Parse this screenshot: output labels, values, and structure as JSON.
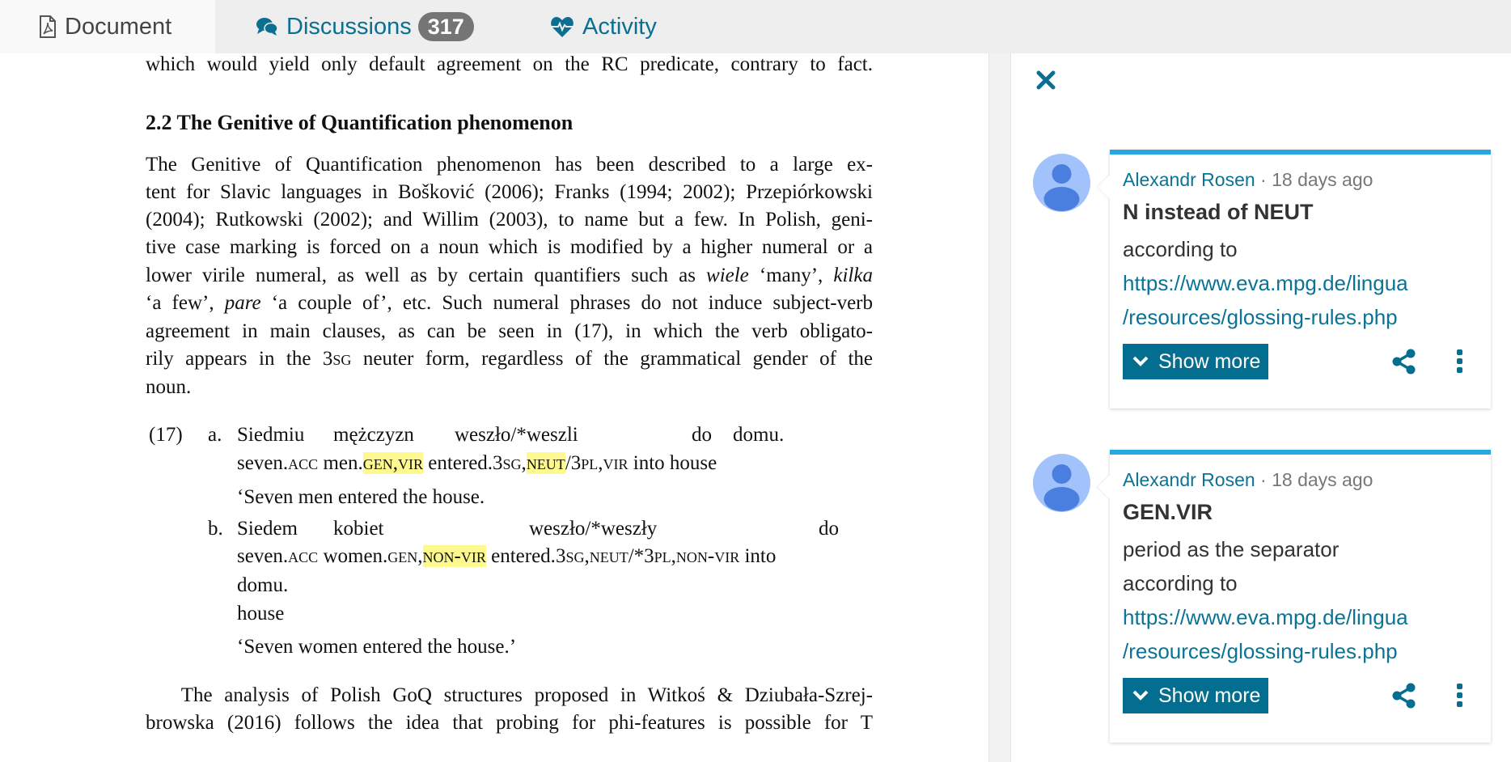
{
  "tabs": {
    "document": "Document",
    "discussions": "Discussions",
    "discussions_count": "317",
    "activity": "Activity"
  },
  "document": {
    "top_line": "which would yield only default agreement on the RC predicate, contrary to fact.",
    "section_heading": "2.2  The Genitive of Quantification phenomenon",
    "paragraph1": [
      [
        {
          "t": "The Genitive of Quantification phenomenon has been described to a large ex-"
        }
      ],
      [
        {
          "t": "tent for Slavic languages in Bošković (2006); Franks (1994; 2002); Przepiórkowski"
        }
      ],
      [
        {
          "t": "(2004); Rutkowski (2002); and Willim (2003), to name but a few. In Polish, geni-"
        }
      ],
      [
        {
          "t": "tive case marking is forced on a noun which is modified by a higher numeral or a"
        }
      ],
      [
        {
          "t": "lower virile numeral, as well as by certain quantifiers such as "
        },
        {
          "t": "wiele",
          "i": true
        },
        {
          "t": " ‘many’, "
        },
        {
          "t": "kilka",
          "i": true
        }
      ],
      [
        {
          "t": "‘a few’, "
        },
        {
          "t": "pare",
          "i": true
        },
        {
          "t": " ‘a couple of’, etc. Such numeral phrases do not induce subject-verb"
        }
      ],
      [
        {
          "t": "agreement in main clauses, as can be seen in (17), in which the verb obligato-"
        }
      ],
      [
        {
          "t": "rily appears in the "
        },
        {
          "t": "3sg",
          "sc": true
        },
        {
          "t": " neuter form, regardless of the grammatical gender of the"
        }
      ],
      [
        {
          "t": "noun.",
          "last": true
        }
      ]
    ],
    "example": {
      "number": "(17)",
      "a": {
        "label": "a.",
        "words": [
          "Siedmiu",
          "mężczyzn",
          "weszło/*weszli",
          "do",
          "domu."
        ],
        "gloss": [
          {
            "t": "seven."
          },
          {
            "t": "acc",
            "sc": true
          },
          {
            "t": " men."
          },
          {
            "t": "gen,vir",
            "sc": true,
            "hl": true
          },
          {
            "t": " entered."
          },
          {
            "t": "3sg,",
            "sc": true
          },
          {
            "t": "neut",
            "sc": true,
            "hl": true
          },
          {
            "t": "/"
          },
          {
            "t": "3pl,vir",
            "sc": true
          },
          {
            "t": " into house"
          }
        ],
        "translation": "‘Seven men entered the house."
      },
      "b": {
        "label": "b.",
        "words": [
          "Siedem",
          "kobiet",
          "weszło/*weszły",
          "do"
        ],
        "gloss": [
          {
            "t": "seven."
          },
          {
            "t": "acc",
            "sc": true
          },
          {
            "t": " women."
          },
          {
            "t": "gen,",
            "sc": true
          },
          {
            "t": "non-vir",
            "sc": true,
            "hl": true
          },
          {
            "t": " entered."
          },
          {
            "t": "3sg,neut",
            "sc": true
          },
          {
            "t": "/*"
          },
          {
            "t": "3pl,non-vir",
            "sc": true
          },
          {
            "t": " into"
          }
        ],
        "word_overflow": "domu.",
        "gloss_overflow": "house",
        "translation": "‘Seven women entered the house.’"
      }
    },
    "paragraph2": [
      "   The analysis of Polish GoQ structures proposed in Witkoś & Dziubała-Szrej-",
      "browska (2016) follows the idea that probing for phi-features is possible for T"
    ]
  },
  "discussions": [
    {
      "author": "Alexandr Rosen",
      "time": " · 18 days ago",
      "title": "N instead of NEUT",
      "body_lines": [
        "according to"
      ],
      "link_lines": [
        "https://www.eva.mpg.de/lingua",
        "/resources/glossing-rules.php"
      ],
      "show_more": "Show more"
    },
    {
      "author": "Alexandr Rosen",
      "time": " · 18 days ago",
      "title": "GEN.VIR",
      "body_lines": [
        "period as the separator",
        "according to"
      ],
      "link_lines": [
        "https://www.eva.mpg.de/lingua",
        "/resources/glossing-rules.php"
      ],
      "show_more": "Show more"
    }
  ],
  "colors": {
    "accent": "#0a7396",
    "card_top": "#29a8e0",
    "highlight": "#fdf98f",
    "button": "#036e8f"
  }
}
